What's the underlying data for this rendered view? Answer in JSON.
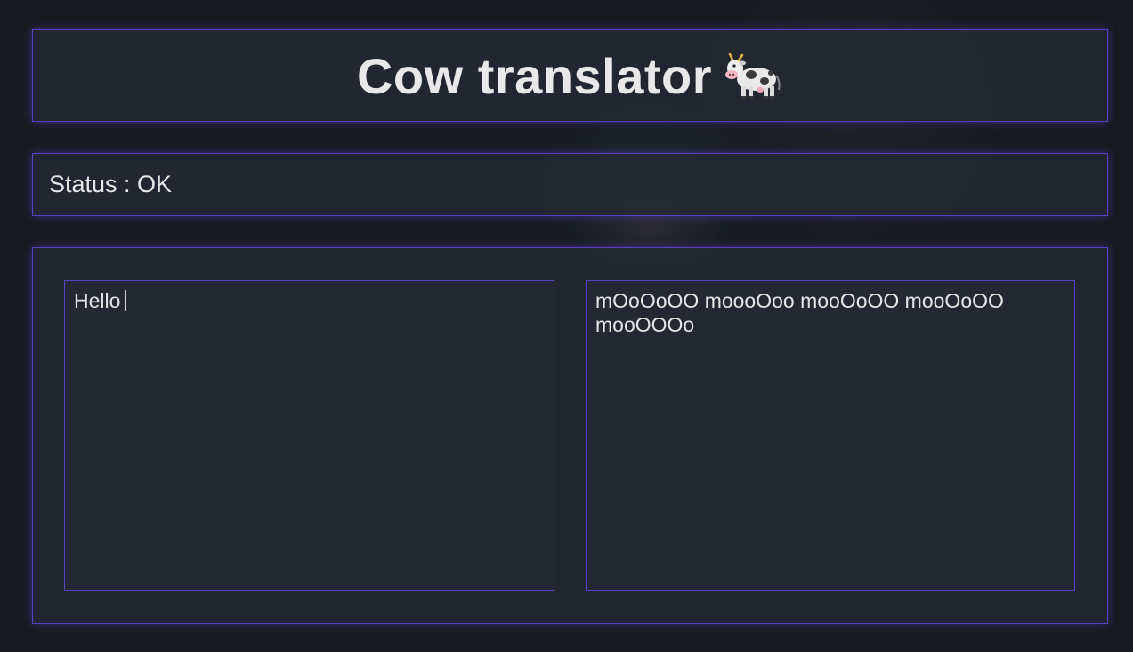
{
  "header": {
    "title": "Cow translator",
    "icon": "cow-icon"
  },
  "status": {
    "text": "Status : OK"
  },
  "translator": {
    "input_value": "Hello",
    "output_value": "mOoOoOO moooOoo mooOoOO mooOoOO mooOOOo"
  },
  "colors": {
    "background": "#171a21",
    "panel": "#252933",
    "border_accent": "#5b3fc4",
    "text": "#e6e6e6"
  }
}
